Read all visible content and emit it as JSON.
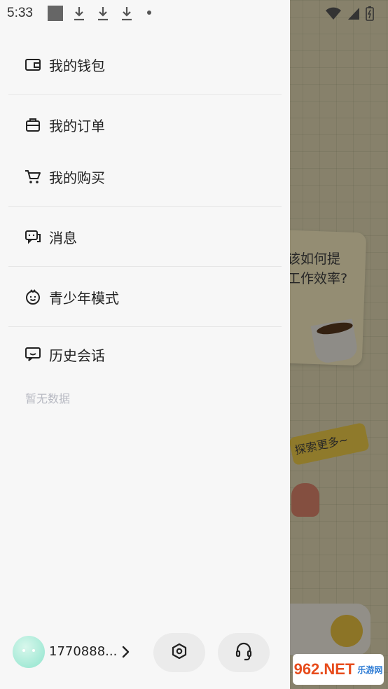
{
  "status_bar": {
    "time": "5:33"
  },
  "menu": {
    "wallet": "我的钱包",
    "orders": "我的订单",
    "purchases": "我的购买",
    "messages": "消息",
    "youth_mode": "青少年模式",
    "history": "历史会话",
    "empty_hint": "暂无数据"
  },
  "user": {
    "phone": "1770888..."
  },
  "background": {
    "card_text_line1": "该如何提",
    "card_text_line2": "工作效率?",
    "explore_tag": "探索更多~"
  },
  "watermark": {
    "main": "962.NET",
    "sub": "乐游网"
  },
  "colors": {
    "drawer_bg": "#f7f7f7",
    "accent_yellow": "#f2c842",
    "avatar_mint": "#8fe4cd"
  }
}
